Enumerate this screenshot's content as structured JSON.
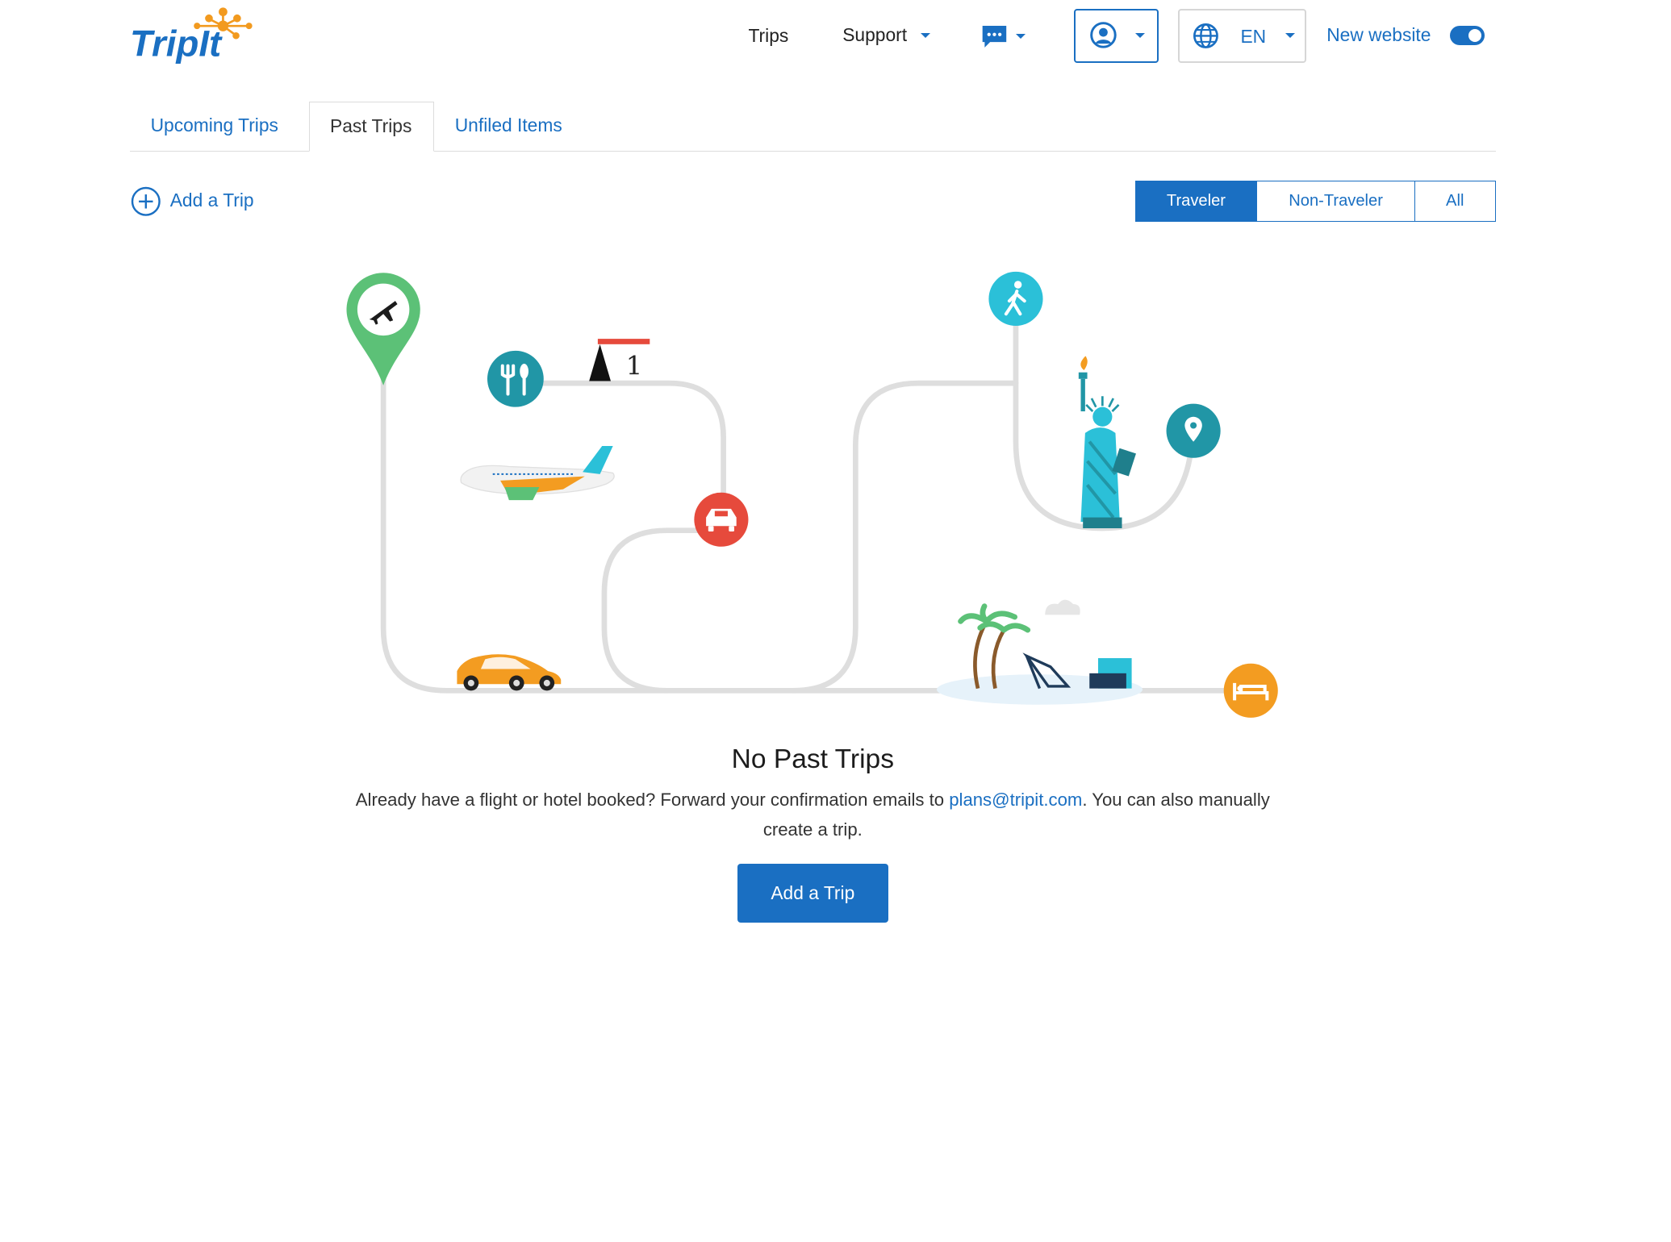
{
  "logo": {
    "text": "TripIt"
  },
  "nav": {
    "trips": "Trips",
    "support": "Support",
    "language": "EN",
    "new_website": "New website",
    "new_website_enabled": true
  },
  "tabs": [
    {
      "label": "Upcoming Trips",
      "active": false
    },
    {
      "label": "Past Trips",
      "active": true
    },
    {
      "label": "Unfiled Items",
      "active": false
    }
  ],
  "add_trip_link": "Add a Trip",
  "filter": {
    "options": [
      "Traveler",
      "Non-Traveler",
      "All"
    ],
    "selected": "Traveler"
  },
  "illustration": {
    "calendar_day": "1"
  },
  "empty_state": {
    "title": "No Past Trips",
    "desc_before": "Already have a flight or hotel booked? Forward your confirmation emails to ",
    "email": "plans@tripit.com",
    "desc_after": ". You can also manually create a trip.",
    "button": "Add a Trip"
  },
  "colors": {
    "brand_blue": "#1a6fc2",
    "green_pin": "#5cc177",
    "teal": "#2196a6",
    "red": "#e64a3c",
    "orange": "#f39c21",
    "cyan": "#2bc0d8"
  }
}
